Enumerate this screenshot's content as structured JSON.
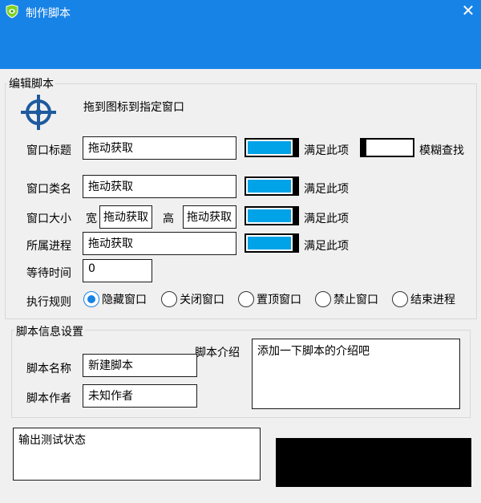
{
  "window": {
    "title": "制作脚本",
    "close_glyph": "✕"
  },
  "edit_group": {
    "label": "编辑脚本",
    "crosshair_hint": "拖到图标到指定窗口",
    "window_title": {
      "label": "窗口标题",
      "value": "拖动获取",
      "match_label": "满足此项",
      "fuzzy_label": "模糊查找"
    },
    "window_class": {
      "label": "窗口类名",
      "value": "拖动获取",
      "match_label": "满足此项"
    },
    "window_size": {
      "label": "窗口大小",
      "width_label": "宽",
      "width_value": "拖动获取",
      "height_label": "高",
      "height_value": "拖动获取",
      "match_label": "满足此项"
    },
    "process": {
      "label": "所属进程",
      "value": "拖动获取",
      "match_label": "满足此项"
    },
    "wait_time": {
      "label": "等待时间",
      "value": "0"
    },
    "exec_rule": {
      "label": "执行规则",
      "options": [
        "隐藏窗口",
        "关闭窗口",
        "置顶窗口",
        "禁止窗口",
        "结束进程"
      ],
      "selected": "隐藏窗口"
    }
  },
  "info_group": {
    "label": "脚本信息设置",
    "name": {
      "label": "脚本名称",
      "value": "新建脚本"
    },
    "author": {
      "label": "脚本作者",
      "value": "未知作者"
    },
    "intro": {
      "label": "脚本介绍",
      "value": "添加一下脚本的介绍吧"
    }
  },
  "output": {
    "text": "输出测试状态"
  },
  "colors": {
    "titlebar": "#1883e6",
    "toggle_fill": "#00a2e8",
    "radio_selected": "#1883e6"
  },
  "icons": {
    "app": "shield-icon",
    "crosshair": "crosshair-target-icon",
    "close": "close-icon"
  }
}
